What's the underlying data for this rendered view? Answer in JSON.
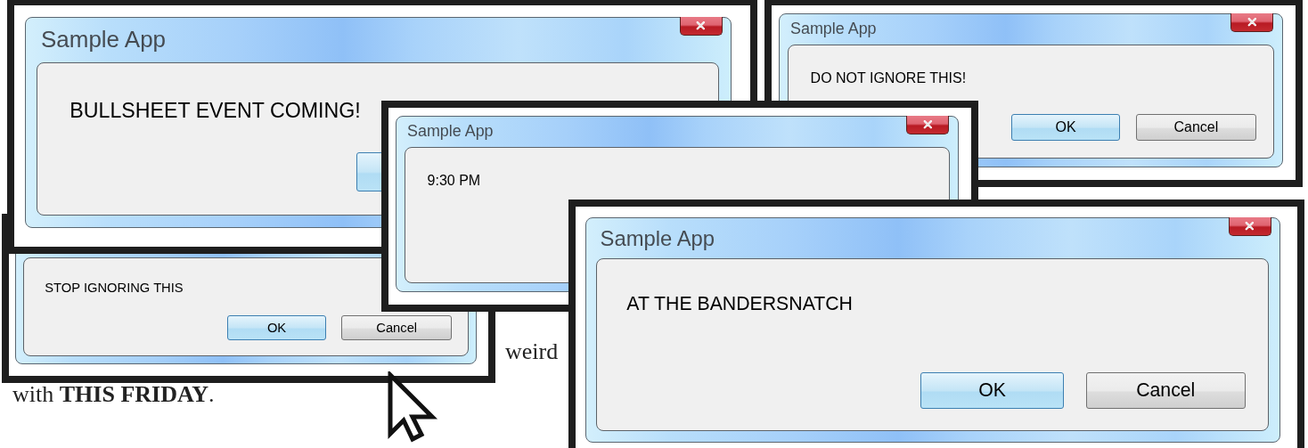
{
  "document": {
    "lines": [
      "weird",
      "with **THIS FRIDAY**."
    ]
  },
  "dialogs": [
    {
      "title": "Sample App",
      "message": "BULLSHEET EVENT COMING!",
      "close": true,
      "buttons": [
        {
          "kind": "default"
        }
      ]
    },
    {
      "title": "Sample App",
      "message": "DO NOT IGNORE THIS!",
      "close": true,
      "buttons": [
        {
          "label": "OK",
          "kind": "default"
        },
        {
          "label": "Cancel",
          "kind": "normal"
        }
      ]
    },
    {
      "title": "Sample App",
      "message": "9:30 PM",
      "close": true
    },
    {
      "message": "STOP IGNORING THIS",
      "buttons": [
        {
          "label": "OK",
          "kind": "default"
        },
        {
          "label": "Cancel",
          "kind": "normal"
        }
      ]
    },
    {
      "title": "Sample App",
      "message": "AT THE BANDERSNATCH",
      "close": true,
      "buttons": [
        {
          "label": "OK",
          "kind": "default"
        },
        {
          "label": "Cancel",
          "kind": "normal"
        }
      ]
    }
  ]
}
